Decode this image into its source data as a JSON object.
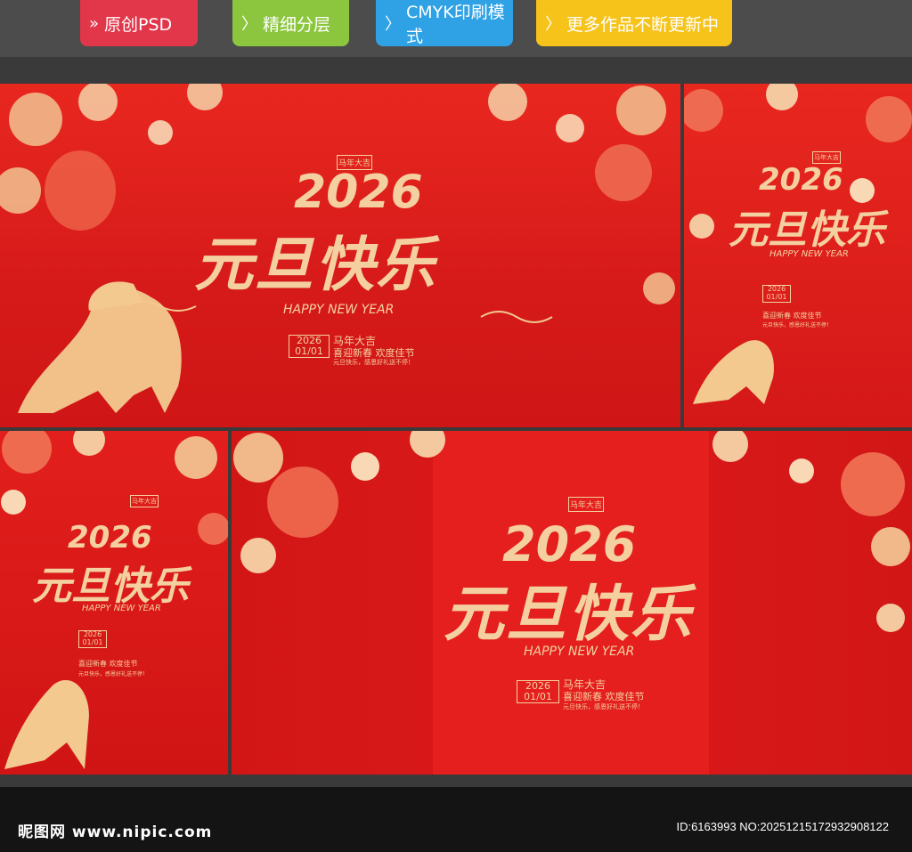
{
  "tabs": [
    {
      "label": "原创PSD",
      "icon": "double-chevron-icon"
    },
    {
      "label": "精细分层",
      "icon": "chevron-icon"
    },
    {
      "label": "CMYK印刷模式",
      "icon": "chevron-icon"
    },
    {
      "label": "更多作品不断更新中",
      "icon": "chevron-icon"
    }
  ],
  "poster": {
    "year": "2026",
    "title": "元旦快乐",
    "subtitle": "HAPPY NEW YEAR",
    "date_year": "2026",
    "date_md": "01/01",
    "line1": "马年大吉",
    "line2": "喜迎新春 欢度佳节",
    "line3": "元旦快乐，感恩好礼送不停！",
    "seal": "马年大吉"
  },
  "footer": {
    "site": "昵图网 www.nipic.com",
    "id": "ID:6163993 NO:20251215172932908122"
  },
  "colors": {
    "accent_red": "#e41f1d",
    "gold": "#f4d0a0"
  }
}
